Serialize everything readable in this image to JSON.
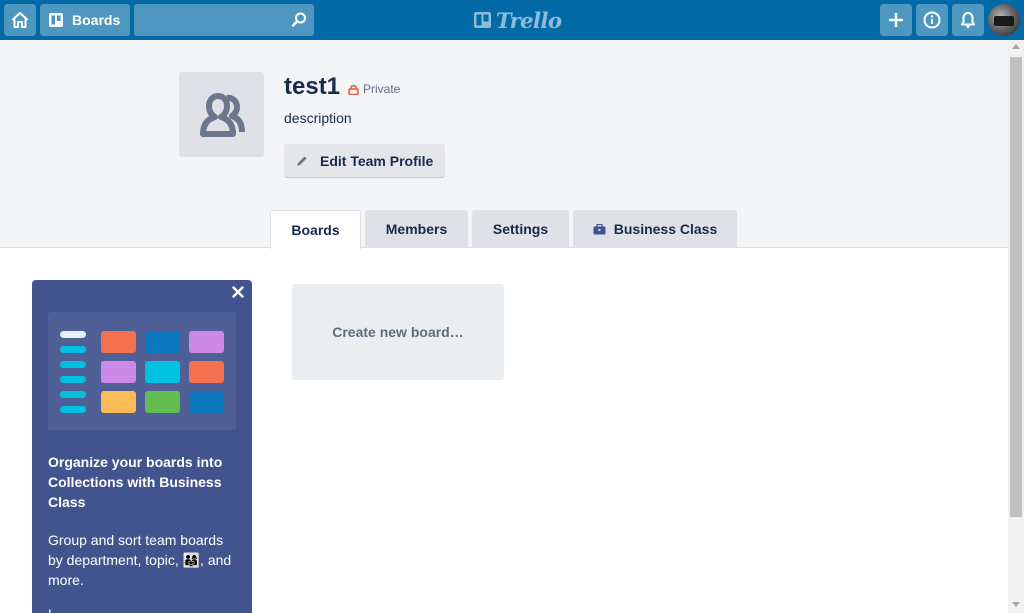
{
  "header": {
    "boards_label": "Boards",
    "logo_text": "Trello",
    "icons": [
      "home-icon",
      "board-icon",
      "search-icon",
      "plus-icon",
      "info-icon",
      "bell-icon"
    ]
  },
  "team": {
    "name": "test1",
    "visibility": "Private",
    "description": "description",
    "edit_label": "Edit Team Profile"
  },
  "tabs": [
    {
      "label": "Boards",
      "active": true
    },
    {
      "label": "Members",
      "active": false
    },
    {
      "label": "Settings",
      "active": false
    },
    {
      "label": "Business Class",
      "active": false
    }
  ],
  "promo": {
    "title": "Organize your boards into Collections with Business Class",
    "body": "Group and sort team boards by department, topic, 👨‍👩‍👧, and more.",
    "more": "L"
  },
  "create_board_label": "Create new board…",
  "colors": {
    "header": "#026aa7",
    "promo_bg": "#42548e",
    "tile_orange": "#f5704f",
    "tile_blue": "#0c79bf",
    "tile_purple": "#cd89e6",
    "tile_cyan": "#00c2e0",
    "tile_yellow": "#fdbb57",
    "tile_green": "#61bd4f"
  }
}
